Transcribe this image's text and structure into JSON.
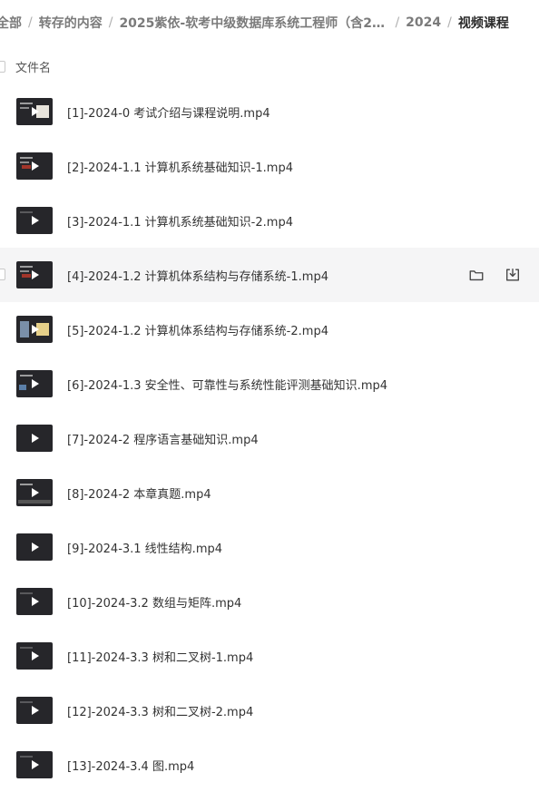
{
  "breadcrumb": {
    "items": [
      {
        "label": "全部"
      },
      {
        "label": "转存的内容"
      },
      {
        "label": "2025紫依-软考中级数据库系统工程师（含20..."
      },
      {
        "label": "2024"
      },
      {
        "label": "视频课程"
      }
    ],
    "separator": "/"
  },
  "list_header": {
    "name_column": "文件名"
  },
  "files": [
    {
      "name": "[1]-2024-0 考试介绍与课程说明.mp4",
      "thumb": "slide"
    },
    {
      "name": "[2]-2024-1.1 计算机系统基础知识-1.mp4",
      "thumb": "red"
    },
    {
      "name": "[3]-2024-1.1 计算机系统基础知识-2.mp4",
      "thumb": "dark"
    },
    {
      "name": "[4]-2024-1.2 计算机体系结构与存储系统-1.mp4",
      "thumb": "red",
      "hovered": true
    },
    {
      "name": "[5]-2024-1.2 计算机体系结构与存储系统-2.mp4",
      "thumb": "panel"
    },
    {
      "name": "[6]-2024-1.3 安全性、可靠性与系统性能评测基础知识.mp4",
      "thumb": "blue"
    },
    {
      "name": "[7]-2024-2 程序语言基础知识.mp4",
      "thumb": "plain"
    },
    {
      "name": "[8]-2024-2 本章真题.mp4",
      "thumb": "strip"
    },
    {
      "name": "[9]-2024-3.1 线性结构.mp4",
      "thumb": "plain"
    },
    {
      "name": "[10]-2024-3.2 数组与矩阵.mp4",
      "thumb": "dark"
    },
    {
      "name": "[11]-2024-3.3 树和二叉树-1.mp4",
      "thumb": "dark"
    },
    {
      "name": "[12]-2024-3.3 树和二叉树-2.mp4",
      "thumb": "dark"
    },
    {
      "name": "[13]-2024-3.4 图.mp4",
      "thumb": "dark"
    }
  ],
  "row_actions": {
    "folder_icon": "folder-icon",
    "download_icon": "download-icon"
  }
}
